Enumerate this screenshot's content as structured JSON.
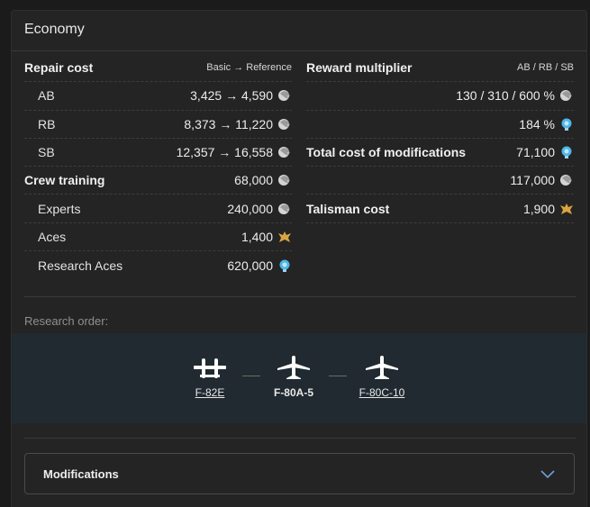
{
  "panel": {
    "title": "Economy"
  },
  "repair": {
    "title": "Repair cost",
    "hint": "Basic → Reference",
    "rows": [
      {
        "label": "AB",
        "value": "3,425 → 4,590",
        "icon": "silver-lion-icon"
      },
      {
        "label": "RB",
        "value": "8,373 → 11,220",
        "icon": "silver-lion-icon"
      },
      {
        "label": "SB",
        "value": "12,357 → 16,558",
        "icon": "silver-lion-icon"
      }
    ]
  },
  "crew": {
    "title": "Crew training",
    "value": "68,000",
    "icon": "silver-lion-icon",
    "rows": [
      {
        "label": "Experts",
        "value": "240,000",
        "icon": "silver-lion-icon"
      },
      {
        "label": "Aces",
        "value": "1,400",
        "icon": "golden-eagle-icon"
      },
      {
        "label": "Research Aces",
        "value": "620,000",
        "icon": "research-bulb-icon"
      }
    ]
  },
  "reward": {
    "title": "Reward multiplier",
    "hint": "AB / RB / SB",
    "rows": [
      {
        "value": "130 / 310 / 600 %",
        "icon": "silver-lion-icon"
      },
      {
        "value": "184 %",
        "icon": "research-bulb-icon"
      }
    ]
  },
  "modifications_cost": {
    "title": "Total cost of modifications",
    "value": "71,100",
    "icon": "research-bulb-icon",
    "extra": {
      "value": "117,000",
      "icon": "silver-lion-icon"
    }
  },
  "talisman": {
    "title": "Talisman cost",
    "value": "1,900",
    "icon": "golden-eagle-icon"
  },
  "research": {
    "label": "Research order:",
    "planes": [
      {
        "name": "F-82E",
        "icon": "twin-boom-plane-icon",
        "current": false
      },
      {
        "name": "F-80A-5",
        "icon": "jet-plane-icon",
        "current": true
      },
      {
        "name": "F-80C-10",
        "icon": "jet-plane-icon",
        "current": false
      }
    ]
  },
  "modifications": {
    "label": "Modifications",
    "icon": "chevron-down-icon"
  },
  "colors": {
    "background": "#1b1b1b",
    "panel": "#242424",
    "research_band": "#202a30",
    "bulb": "#4fb6e8",
    "eagle": "#d9a441",
    "chevron": "#6aa0d8"
  }
}
